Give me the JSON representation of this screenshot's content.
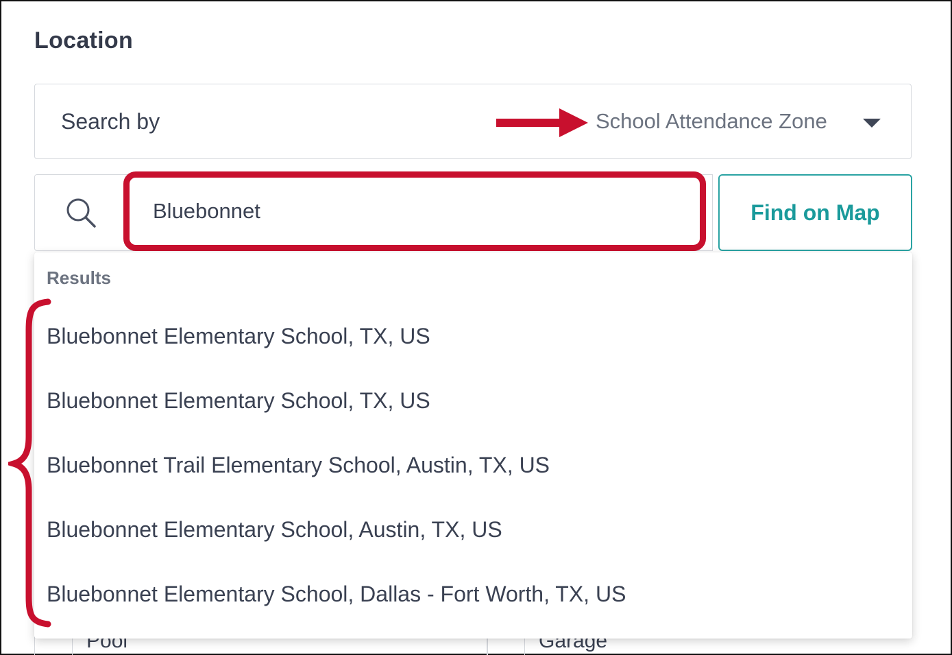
{
  "section": {
    "title": "Location"
  },
  "search_by": {
    "label": "Search by",
    "selected": "School Attendance Zone",
    "caret_icon": "caret-down-icon"
  },
  "search": {
    "value": "Bluebonnet",
    "icon": "search-icon",
    "button_label": "Find on Map"
  },
  "results": {
    "heading": "Results",
    "items": [
      "Bluebonnet Elementary School, TX, US",
      "Bluebonnet Elementary School, TX, US",
      "Bluebonnet Trail Elementary School, Austin, TX, US",
      "Bluebonnet Elementary School, Austin, TX, US",
      "Bluebonnet Elementary School, Dallas - Fort Worth, TX, US"
    ]
  },
  "background_fields": {
    "left": "Pool",
    "right": "Garage"
  },
  "colors": {
    "accent": "#1a9a9b",
    "annotation_red": "#c8102e"
  }
}
